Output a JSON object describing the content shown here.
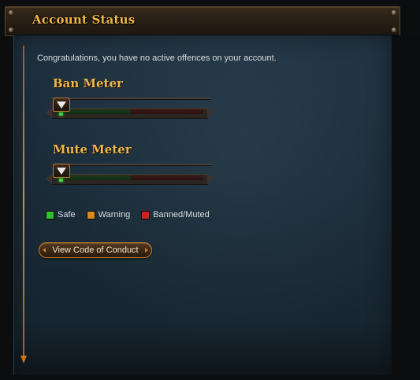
{
  "header": {
    "title": "Account Status"
  },
  "intro_text": "Congratulations, you have no active offences on your account.",
  "meters": [
    {
      "title": "Ban Meter",
      "level": 0.0
    },
    {
      "title": "Mute Meter",
      "level": 0.0
    }
  ],
  "legend": [
    {
      "label": "Safe",
      "color": "#2fbf2f"
    },
    {
      "label": "Warning",
      "color": "#d98a1f"
    },
    {
      "label": "Banned/Muted",
      "color": "#cc2222"
    }
  ],
  "actions": {
    "code_of_conduct": "View Code of Conduct"
  },
  "colors": {
    "accent_gold": "#f0b642",
    "accent_orange": "#c6802a",
    "panel_bg": "#1a2b38"
  }
}
